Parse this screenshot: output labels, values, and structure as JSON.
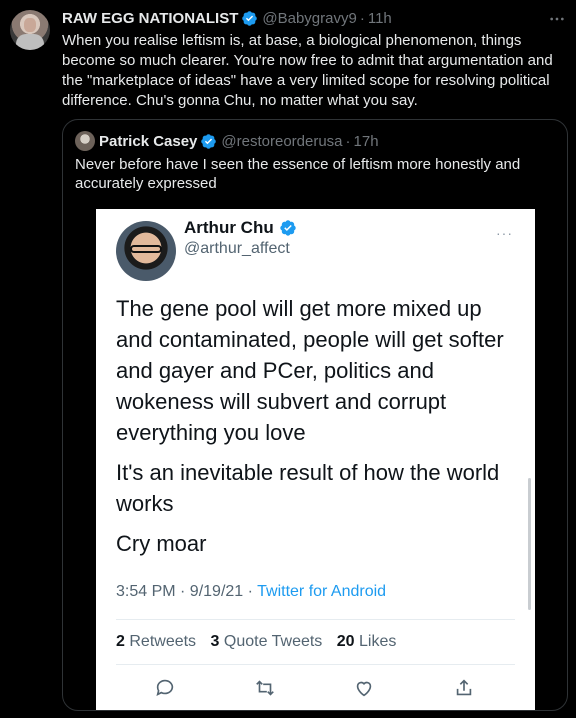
{
  "tweet": {
    "author_name": "RAW EGG NATIONALIST",
    "handle": "@Babygravy9",
    "separator": "·",
    "time": "11h",
    "text": "When you realise leftism is, at base, a biological phenomenon, things become so much clearer. You're now free to admit that argumentation and the \"marketplace of ideas\" have a very limited scope for resolving political difference. Chu's gonna Chu, no matter what you say."
  },
  "quoted": {
    "author_name": "Patrick Casey",
    "handle": "@restoreorderusa",
    "separator": "·",
    "time": "17h",
    "text": "Never before have I seen the essence of leftism more honestly and accurately expressed"
  },
  "screenshot": {
    "author_name": "Arthur Chu",
    "handle": "@arthur_affect",
    "more": "···",
    "paragraphs": [
      "The gene pool will get more mixed up and contaminated, people will get softer and gayer and PCer, politics and wokeness will subvert and corrupt everything you love",
      "It's an inevitable result of how the world works",
      "Cry moar"
    ],
    "timestamp": "3:54 PM · 9/19/21 · ",
    "source": "Twitter for Android",
    "retweets_count": "2",
    "retweets_label": "Retweets",
    "quotes_count": "3",
    "quotes_label": "Quote Tweets",
    "likes_count": "20",
    "likes_label": "Likes"
  },
  "icons": {
    "verified": "verified-badge-icon",
    "more": "more-horizontal-icon",
    "reply": "reply-icon",
    "retweet": "retweet-icon",
    "like": "heart-icon",
    "share": "share-icon"
  },
  "colors": {
    "background": "#000000",
    "text": "#e7e9ea",
    "muted": "#71767b",
    "accent": "#1d9bf0",
    "border": "#2f3336"
  }
}
